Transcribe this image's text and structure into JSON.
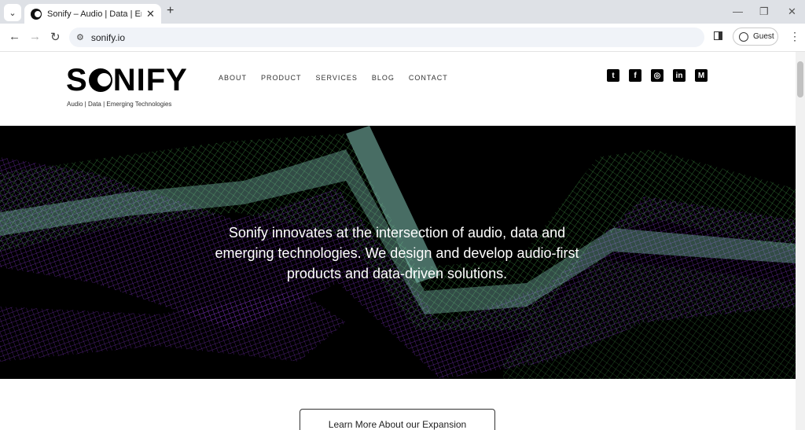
{
  "browser": {
    "tab_title": "Sonify – Audio | Data | Emerging Technologies",
    "url": "sonify.io",
    "profile_label": "Guest"
  },
  "site": {
    "logo_text_left": "S",
    "logo_text_right": "NIFY",
    "tagline": "Audio | Data | Emerging Technologies",
    "nav": [
      "ABOUT",
      "PRODUCT",
      "SERVICES",
      "BLOG",
      "CONTACT"
    ],
    "socials": [
      "twitter-icon",
      "facebook-icon",
      "instagram-icon",
      "linkedin-icon",
      "medium-icon"
    ],
    "hero_text": "Sonify innovates at the intersection of audio, data and emerging technologies. We design and develop audio-first products and data-driven solutions.",
    "cta_label": "Learn More About our Expansion"
  },
  "colors": {
    "hero_bg": "#000000",
    "mesh_green": "#4caf50",
    "mesh_purple": "#7b2fbe",
    "mesh_teal": "#8fd9c8"
  }
}
